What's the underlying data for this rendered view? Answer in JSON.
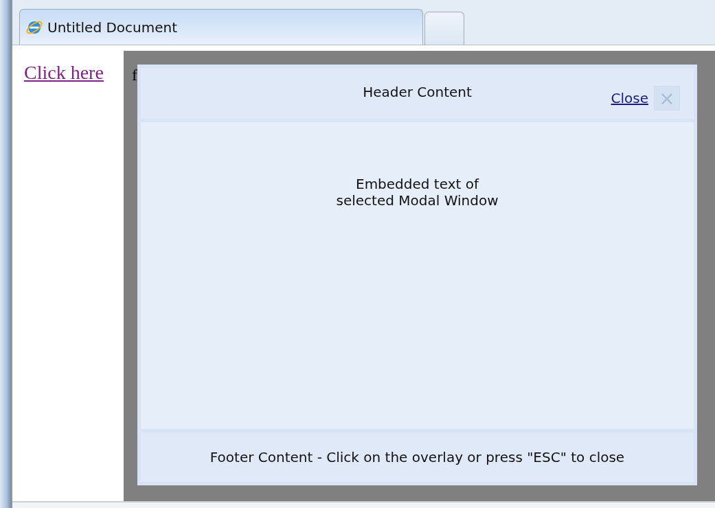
{
  "tabs": [
    {
      "label": "Untitled Document",
      "selected": true
    },
    {
      "selected": false
    }
  ],
  "page": {
    "link": "Click here",
    "text": "f"
  },
  "modal": {
    "header": "Header Content",
    "close_link": "Close",
    "close_icon": "×",
    "body": [
      "Embedded text of",
      "selected Modal Window"
    ],
    "footer": "Footer Content - Click on the overlay or press \"ESC\" to close"
  }
}
